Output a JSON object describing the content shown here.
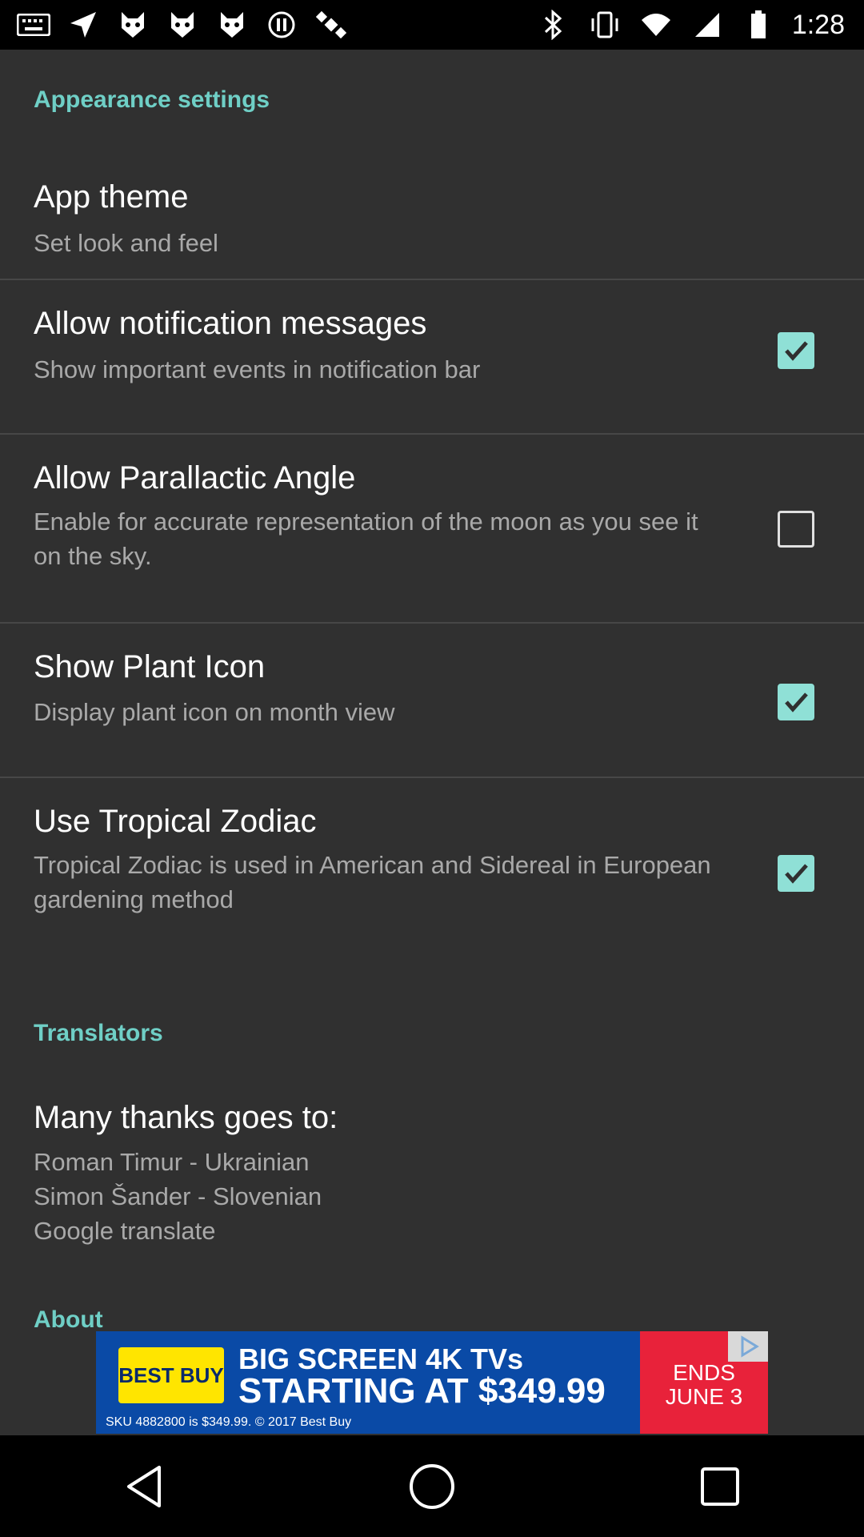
{
  "status_bar": {
    "time": "1:28",
    "left_icons": [
      "keyboard-icon",
      "navigation-icon",
      "cat-icon",
      "cat-icon",
      "cat-icon",
      "fake-gps-icon",
      "satellite-icon"
    ],
    "right_icons": [
      "bluetooth-icon",
      "vibrate-icon",
      "wifi-icon",
      "signal-icon",
      "battery-icon"
    ]
  },
  "appearance": {
    "header": "Appearance settings",
    "items": [
      {
        "title": "App theme",
        "subtitle": "Set look and feel",
        "has_checkbox": false
      },
      {
        "title": "Allow notification messages",
        "subtitle": "Show important events in notification bar",
        "checked": true
      },
      {
        "title": "Allow Parallactic Angle",
        "subtitle": "Enable for accurate representation of the moon as you see it on the sky.",
        "checked": false
      },
      {
        "title": "Show Plant Icon",
        "subtitle": "Display plant icon on month view",
        "checked": true
      },
      {
        "title": "Use Tropical Zodiac",
        "subtitle": "Tropical Zodiac is used in American and Sidereal in European gardening method",
        "checked": true
      }
    ]
  },
  "translators": {
    "header": "Translators",
    "title": "Many thanks goes to:",
    "lines": "Roman Timur - Ukrainian\nSimon Šander - Slovenian\nGoogle translate"
  },
  "about": {
    "header": "About"
  },
  "ad": {
    "brand": "BEST BUY",
    "line1": "BIG SCREEN 4K TVs",
    "line2": "STARTING AT $349.99",
    "legal": "SKU 4882800 is $349.99. © 2017 Best Buy",
    "ends_line1": "ENDS",
    "ends_line2": "JUNE 3"
  },
  "colors": {
    "accent": "#6fcfc6",
    "checkbox_checked": "#8fe0d6",
    "background": "#303030"
  }
}
